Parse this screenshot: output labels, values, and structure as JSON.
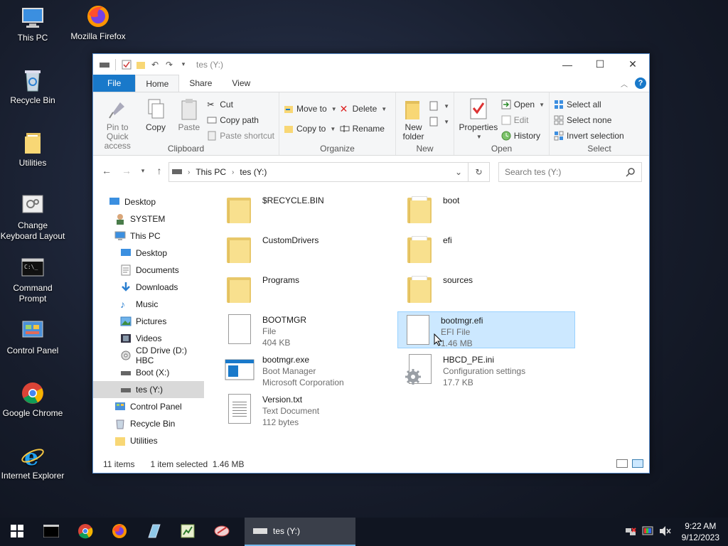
{
  "desktop": {
    "icons": [
      {
        "label": "This PC"
      },
      {
        "label": "Mozilla Firefox"
      },
      {
        "label": "Recycle Bin"
      },
      {
        "label": "Utilities"
      },
      {
        "label": "Change Keyboard Layout"
      },
      {
        "label": "Command Prompt"
      },
      {
        "label": "Control Panel"
      },
      {
        "label": "Google Chrome"
      },
      {
        "label": "Internet Explorer"
      }
    ]
  },
  "window": {
    "title": "tes (Y:)",
    "tabs": {
      "file": "File",
      "home": "Home",
      "share": "Share",
      "view": "View"
    },
    "ribbon": {
      "clipboard": {
        "label": "Clipboard",
        "pin": "Pin to Quick access",
        "copy": "Copy",
        "paste": "Paste",
        "cut": "Cut",
        "copy_path": "Copy path",
        "paste_shortcut": "Paste shortcut"
      },
      "organize": {
        "label": "Organize",
        "move_to": "Move to",
        "copy_to": "Copy to",
        "delete": "Delete",
        "rename": "Rename"
      },
      "new": {
        "label": "New",
        "new_folder": "New folder"
      },
      "open": {
        "label": "Open",
        "properties": "Properties",
        "open": "Open",
        "edit": "Edit",
        "history": "History"
      },
      "select": {
        "label": "Select",
        "select_all": "Select all",
        "select_none": "Select none",
        "invert": "Invert selection"
      }
    },
    "address": {
      "this_pc": "This PC",
      "drive": "tes (Y:)"
    },
    "search_placeholder": "Search tes (Y:)",
    "nav": [
      {
        "label": "Desktop"
      },
      {
        "label": "SYSTEM"
      },
      {
        "label": "This PC"
      },
      {
        "label": "Desktop"
      },
      {
        "label": "Documents"
      },
      {
        "label": "Downloads"
      },
      {
        "label": "Music"
      },
      {
        "label": "Pictures"
      },
      {
        "label": "Videos"
      },
      {
        "label": "CD Drive (D:) HBC"
      },
      {
        "label": "Boot (X:)"
      },
      {
        "label": "tes (Y:)"
      },
      {
        "label": "Control Panel"
      },
      {
        "label": "Recycle Bin"
      },
      {
        "label": "Utilities"
      }
    ],
    "files": [
      {
        "name": "$RECYCLE.BIN",
        "sub1": "",
        "sub2": ""
      },
      {
        "name": "boot",
        "sub1": "",
        "sub2": ""
      },
      {
        "name": "CustomDrivers",
        "sub1": "",
        "sub2": ""
      },
      {
        "name": "efi",
        "sub1": "",
        "sub2": ""
      },
      {
        "name": "Programs",
        "sub1": "",
        "sub2": ""
      },
      {
        "name": "sources",
        "sub1": "",
        "sub2": ""
      },
      {
        "name": "BOOTMGR",
        "sub1": "File",
        "sub2": "404 KB"
      },
      {
        "name": "bootmgr.efi",
        "sub1": "EFI File",
        "sub2": "1.46 MB"
      },
      {
        "name": "bootmgr.exe",
        "sub1": "Boot Manager",
        "sub2": "Microsoft Corporation"
      },
      {
        "name": "HBCD_PE.ini",
        "sub1": "Configuration settings",
        "sub2": "17.7 KB"
      },
      {
        "name": "Version.txt",
        "sub1": "Text Document",
        "sub2": "112 bytes"
      }
    ],
    "status": {
      "count": "11 items",
      "selected": "1 item selected",
      "size": "1.46 MB"
    }
  },
  "taskbar": {
    "task_label": "tes (Y:)",
    "time": "9:22 AM",
    "date": "9/12/2023"
  },
  "colors": {
    "accent": "#1979ca",
    "selection": "#cce8ff",
    "folder": "#f8e08e"
  }
}
